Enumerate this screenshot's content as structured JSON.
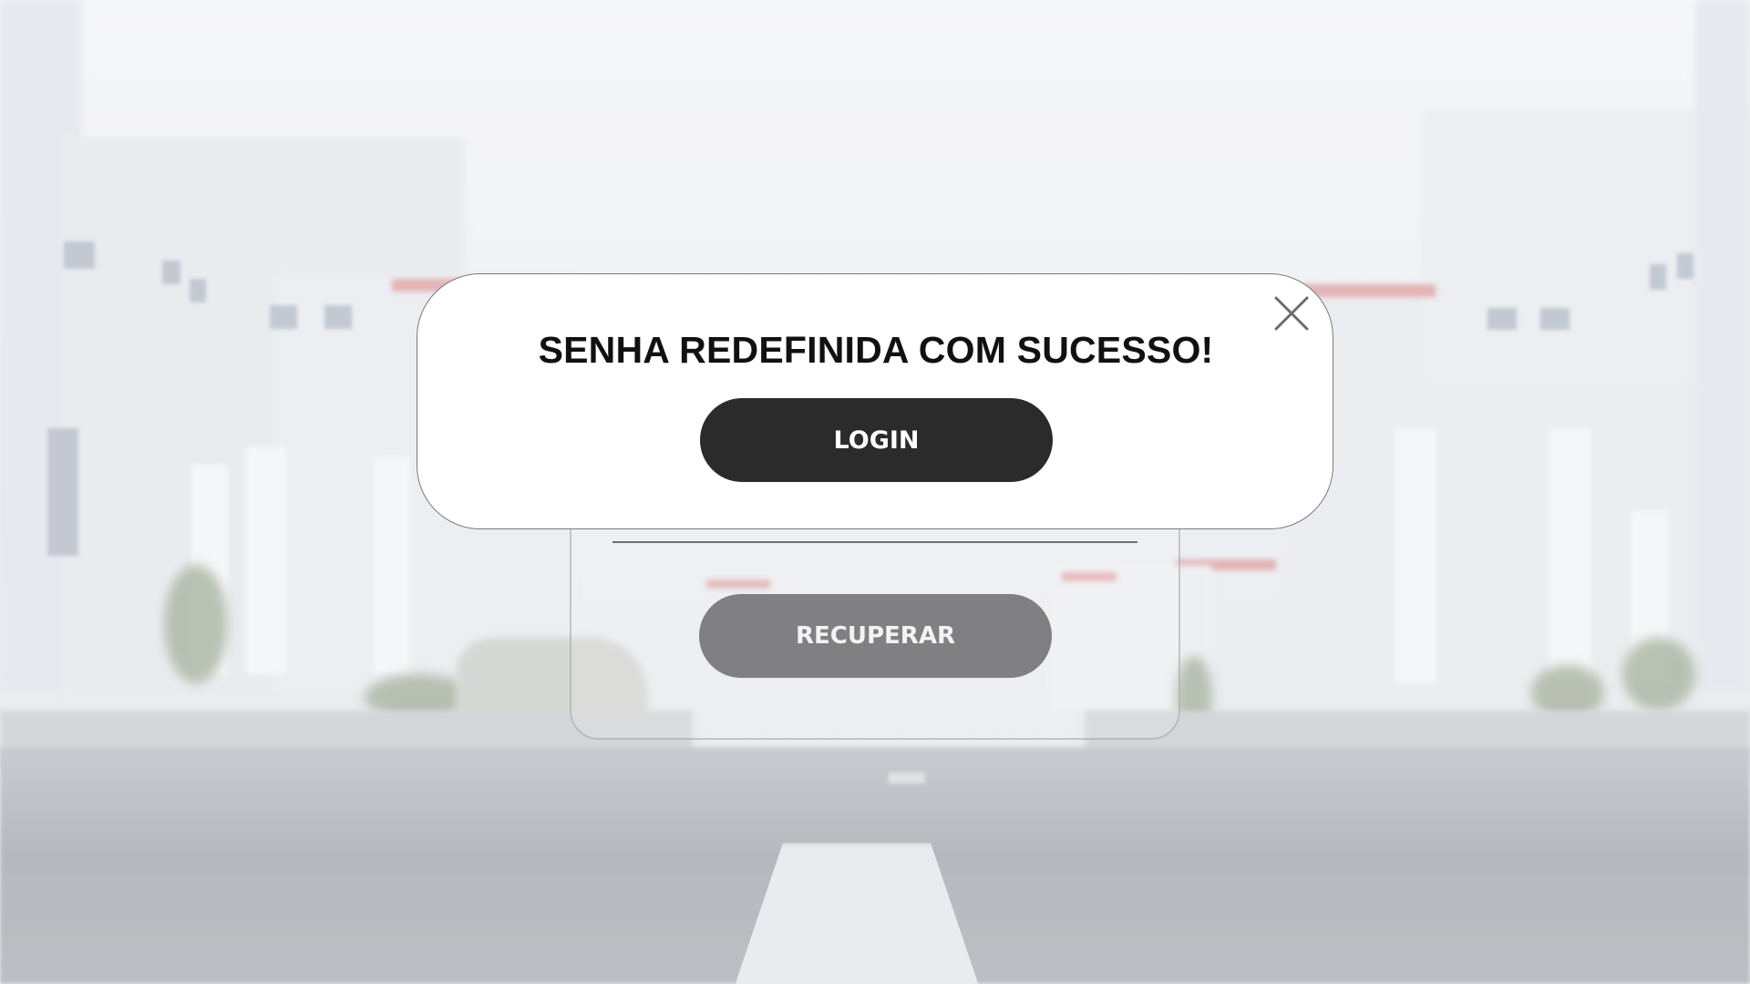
{
  "modal": {
    "title": "SENHA REDEFINIDA COM SUCESSO!",
    "login_label": "LOGIN",
    "close_icon": "close-icon"
  },
  "form": {
    "recover_label": "RECUPERAR"
  },
  "colors": {
    "modal_background": "#ffffff",
    "primary_button": "#2b2b2b",
    "secondary_button": "#6c6c6e"
  }
}
